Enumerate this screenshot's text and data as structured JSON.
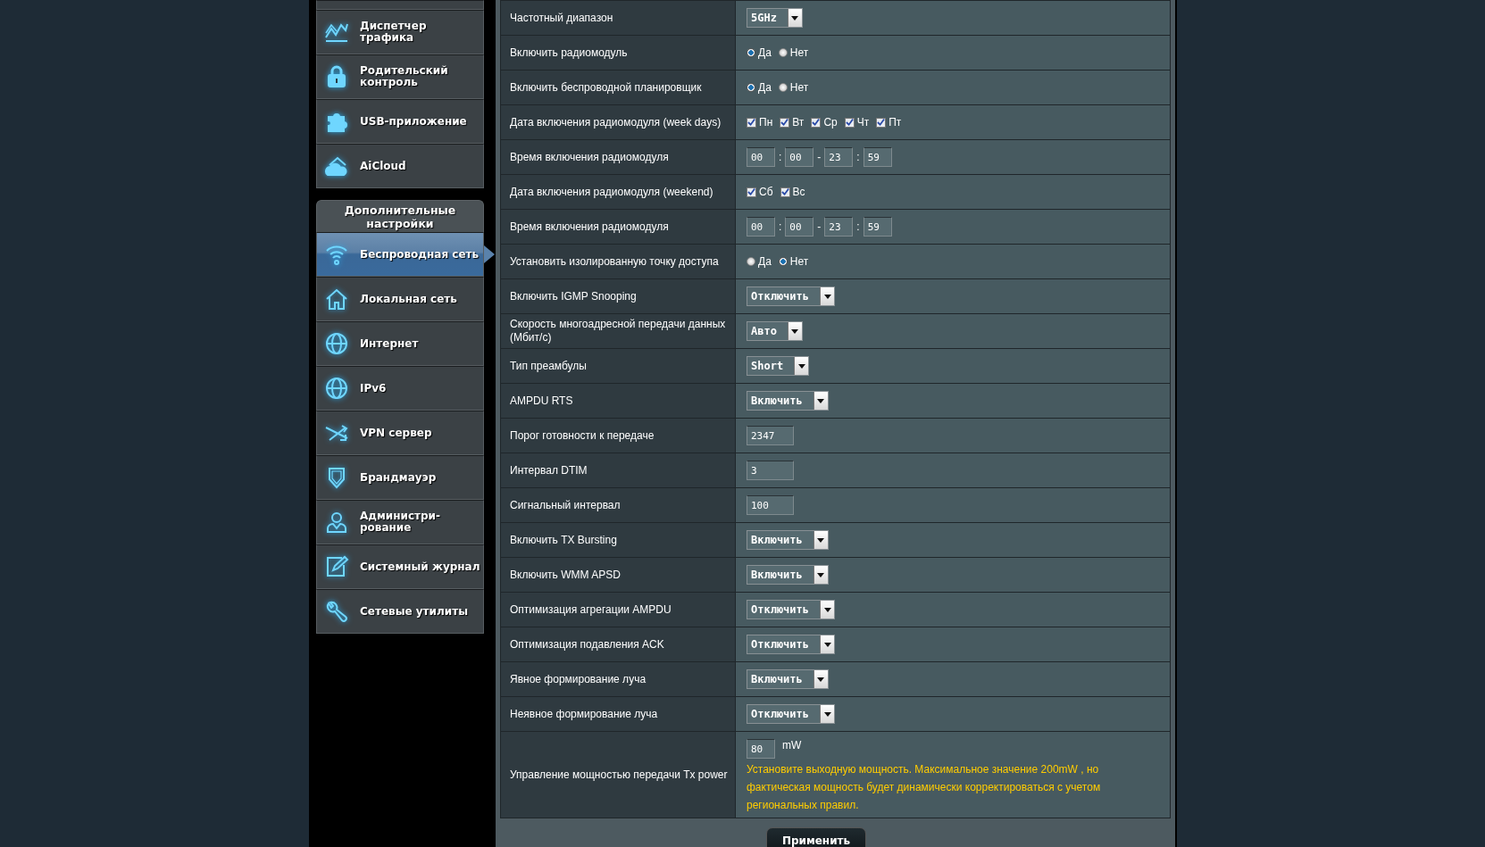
{
  "sidebar": {
    "top_items": [
      {
        "label": "Диспетчер трафика",
        "selected": false
      },
      {
        "label": "Родительский контроль",
        "selected": false
      },
      {
        "label": "USB-приложение",
        "selected": false
      },
      {
        "label": "AiCloud",
        "selected": false
      }
    ],
    "section_title": "Дополнительные настройки",
    "advanced_items": [
      {
        "label": "Беспроводная сеть",
        "selected": true
      },
      {
        "label": "Локальная сеть",
        "selected": false
      },
      {
        "label": "Интернет",
        "selected": false
      },
      {
        "label": "IPv6",
        "selected": false
      },
      {
        "label": "VPN сервер",
        "selected": false
      },
      {
        "label": "Брандмауэр",
        "selected": false
      },
      {
        "label": "Администри-рование",
        "selected": false
      },
      {
        "label": "Системный журнал",
        "selected": false
      },
      {
        "label": "Сетевые утилиты",
        "selected": false
      }
    ]
  },
  "settings": [
    {
      "kind": "select",
      "label": "Частотный диапазон",
      "value": "5GHz"
    },
    {
      "kind": "radio",
      "label": "Включить радиомодуль",
      "options": [
        {
          "label": "Да",
          "selected": true
        },
        {
          "label": "Нет",
          "selected": false
        }
      ]
    },
    {
      "kind": "radio",
      "label": "Включить беспроводной планировщик",
      "options": [
        {
          "label": "Да",
          "selected": true
        },
        {
          "label": "Нет",
          "selected": false
        }
      ]
    },
    {
      "kind": "checkboxes",
      "label": "Дата включения радиомодуля (week days)",
      "options": [
        {
          "label": "Пн",
          "checked": true
        },
        {
          "label": "Вт",
          "checked": true
        },
        {
          "label": "Ср",
          "checked": true
        },
        {
          "label": "Чт",
          "checked": true
        },
        {
          "label": "Пт",
          "checked": true
        }
      ]
    },
    {
      "kind": "time",
      "label": "Время включения радиомодуля",
      "values": [
        "00",
        "00",
        "23",
        "59"
      ],
      "separators": [
        ":",
        "-",
        ":"
      ]
    },
    {
      "kind": "checkboxes",
      "label": "Дата включения радиомодуля (weekend)",
      "options": [
        {
          "label": "Сб",
          "checked": true
        },
        {
          "label": "Вс",
          "checked": true
        }
      ]
    },
    {
      "kind": "time",
      "label": "Время включения радиомодуля",
      "values": [
        "00",
        "00",
        "23",
        "59"
      ],
      "separators": [
        ":",
        "-",
        ":"
      ]
    },
    {
      "kind": "radio",
      "label": "Установить изолированную точку доступа",
      "options": [
        {
          "label": "Да",
          "selected": false
        },
        {
          "label": "Нет",
          "selected": true
        }
      ]
    },
    {
      "kind": "select",
      "label": "Включить IGMP Snooping",
      "value": "Отключить"
    },
    {
      "kind": "select",
      "label": "Скорость многоадресной передачи данных (Мбит/с)",
      "value": "Авто"
    },
    {
      "kind": "select",
      "label": "Тип преамбулы",
      "value": "Short"
    },
    {
      "kind": "select",
      "label": "AMPDU RTS",
      "value": "Включить"
    },
    {
      "kind": "text",
      "label": "Порог готовности к передаче",
      "value": "2347"
    },
    {
      "kind": "text",
      "label": "Интервал DTIM",
      "value": "3"
    },
    {
      "kind": "text",
      "label": "Сигнальный интервал",
      "value": "100"
    },
    {
      "kind": "select",
      "label": "Включить TX Bursting",
      "value": "Включить"
    },
    {
      "kind": "select",
      "label": "Включить WMM APSD",
      "value": "Включить"
    },
    {
      "kind": "select",
      "label": "Оптимизация агрегации AMPDU",
      "value": "Отключить"
    },
    {
      "kind": "select",
      "label": "Оптимизация подавления ACK",
      "value": "Отключить"
    },
    {
      "kind": "select",
      "label": "Явное формирование луча",
      "value": "Включить"
    },
    {
      "kind": "select",
      "label": "Неявное формирование луча",
      "value": "Отключить"
    },
    {
      "kind": "power",
      "label": "Управление мощностью передачи Tx power",
      "value": "80",
      "unit": "mW",
      "hint": "Установите выходную мощность. Максимальное значение 200mW , но фактическая мощность будет динамически корректироваться с учетом региональных правил."
    }
  ],
  "apply_button": "Применить"
}
